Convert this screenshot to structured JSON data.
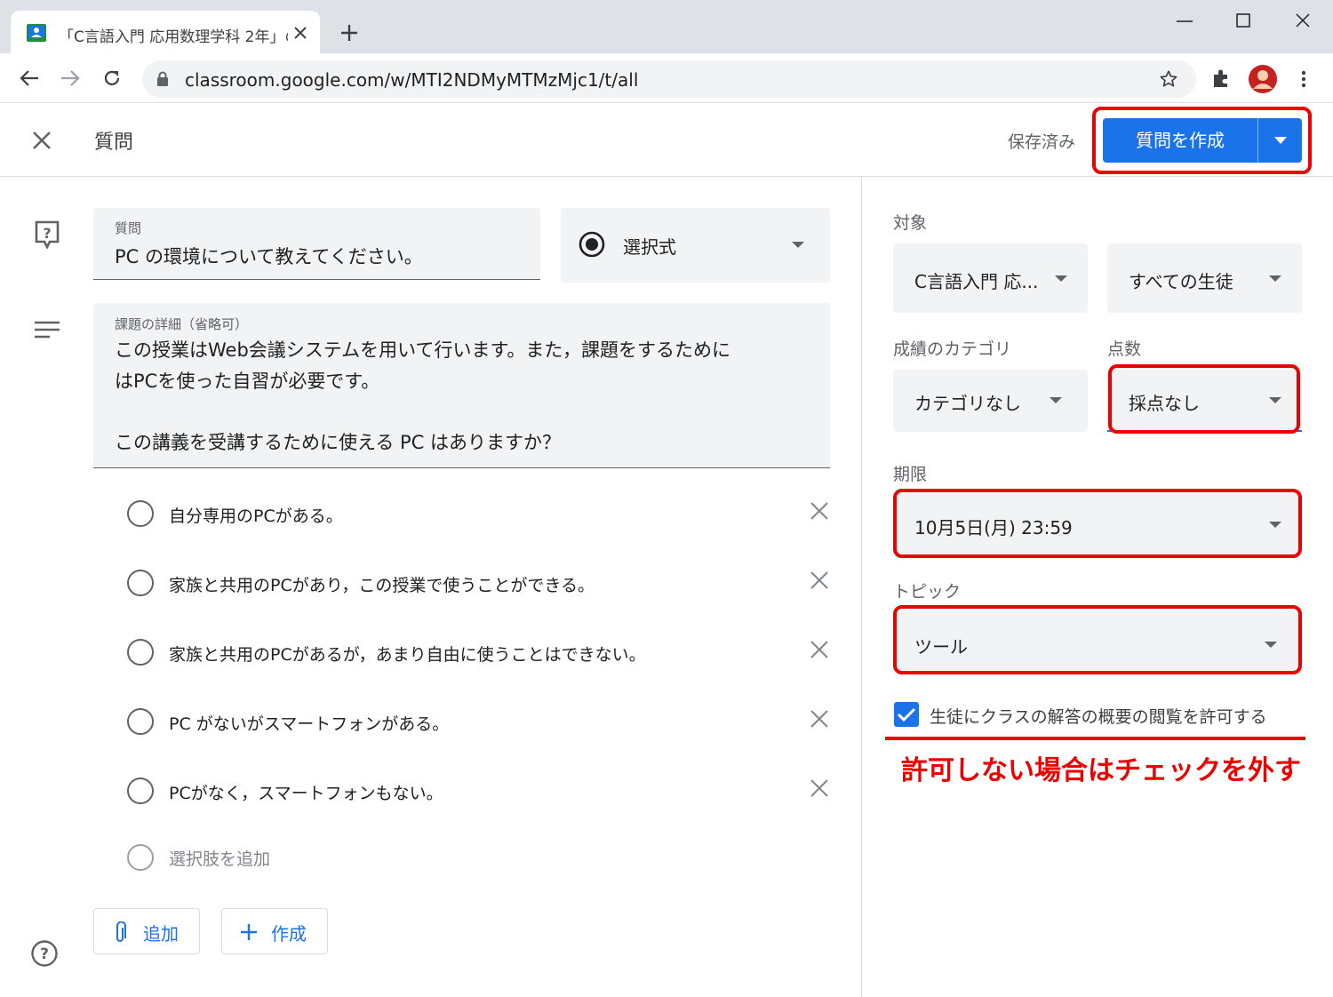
{
  "browser": {
    "tab_title": "「C言語入門 応用数理学科 2年」の",
    "url": "classroom.google.com/w/MTI2NDMyMTMzMjc1/t/all"
  },
  "header": {
    "title": "質問",
    "saved_status": "保存済み",
    "create_button": "質問を作成"
  },
  "question": {
    "label": "質問",
    "value": "PC の環境について教えてください。",
    "type": "選択式"
  },
  "details": {
    "label": "課題の詳細（省略可）",
    "line1": "この授業はWeb会議システムを用いて行います。また，課題をするために",
    "line2": "はPCを使った自習が必要です。",
    "line3": "この講義を受講するために使える PC はありますか？"
  },
  "options": [
    "自分専用のPCがある。",
    "家族と共用のPCがあり，この授業で使うことができる。",
    "家族と共用のPCがあるが，あまり自由に使うことはできない。",
    "PC がないがスマートフォンがある。",
    "PCがなく，スマートフォンもない。"
  ],
  "add_option": "選択肢を追加",
  "buttons": {
    "attach": "追加",
    "create": "作成"
  },
  "sidebar": {
    "for_label": "対象",
    "class_value": "C言語入門 応...",
    "students_value": "すべての生徒",
    "category_label": "成績のカテゴリ",
    "category_value": "カテゴリなし",
    "points_label": "点数",
    "points_value": "採点なし",
    "due_label": "期限",
    "due_value": "10月5日(月) 23:59",
    "topic_label": "トピック",
    "topic_value": "ツール",
    "allow_summary": "生徒にクラスの解答の概要の閲覧を許可する",
    "allow_summary_checked": true
  },
  "annotation": {
    "text": "許可しない場合はチェックを外す",
    "color": "#ee0000"
  },
  "colors": {
    "accent": "#1a73e8",
    "highlight": "#ee0000"
  }
}
